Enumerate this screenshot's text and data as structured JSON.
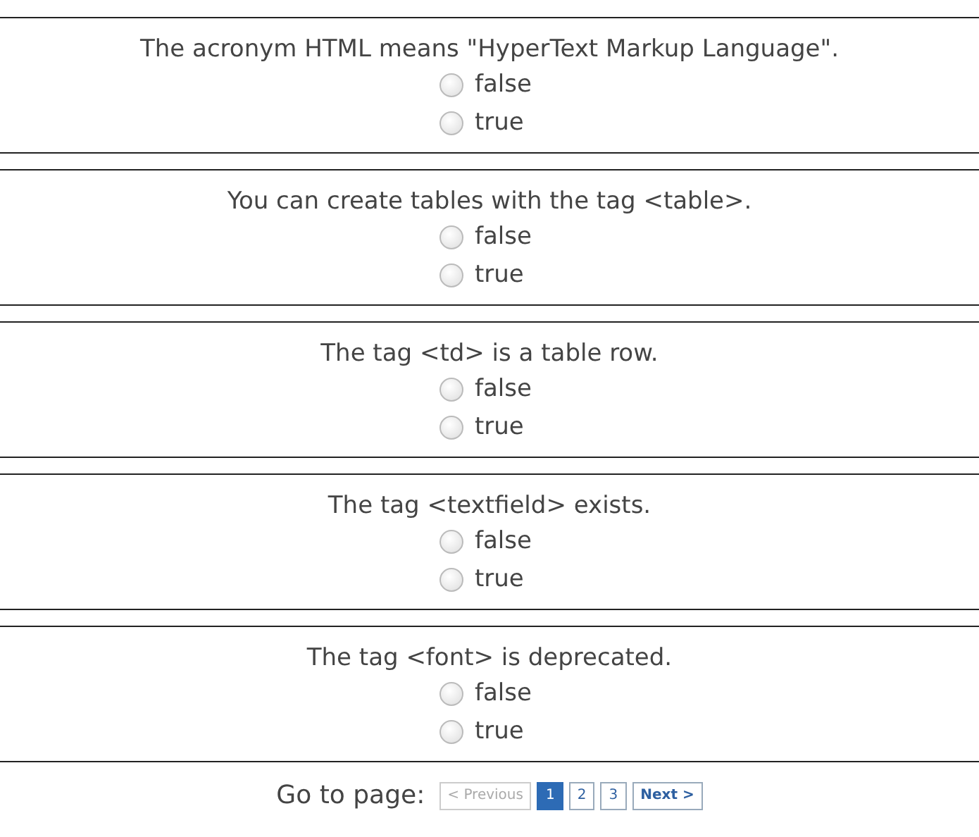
{
  "questions": [
    {
      "text": "The acronym HTML means \"HyperText Markup Language\".",
      "options": [
        {
          "label": "false",
          "selected": false
        },
        {
          "label": "true",
          "selected": false
        }
      ]
    },
    {
      "text": "You can create tables with the tag <table>.",
      "options": [
        {
          "label": "false",
          "selected": false
        },
        {
          "label": "true",
          "selected": false
        }
      ]
    },
    {
      "text": "The tag <td> is a table row.",
      "options": [
        {
          "label": "false",
          "selected": false
        },
        {
          "label": "true",
          "selected": false
        }
      ]
    },
    {
      "text": "The tag <textfield> exists.",
      "options": [
        {
          "label": "false",
          "selected": false
        },
        {
          "label": "true",
          "selected": false
        }
      ]
    },
    {
      "text": "The tag <font> is deprecated.",
      "options": [
        {
          "label": "false",
          "selected": false
        },
        {
          "label": "true",
          "selected": false
        }
      ]
    }
  ],
  "pagination": {
    "label": "Go to page:",
    "items": [
      {
        "text": "< Previous",
        "kind": "nav",
        "disabled": true,
        "selected": false
      },
      {
        "text": "1",
        "kind": "page",
        "disabled": false,
        "selected": true
      },
      {
        "text": "2",
        "kind": "page",
        "disabled": false,
        "selected": false
      },
      {
        "text": "3",
        "kind": "page",
        "disabled": false,
        "selected": false
      },
      {
        "text": "Next >",
        "kind": "nav",
        "disabled": false,
        "selected": false
      }
    ]
  }
}
